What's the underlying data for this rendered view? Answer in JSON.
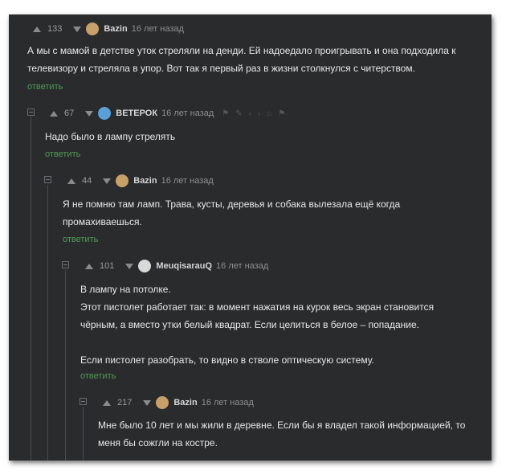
{
  "reply_label": "ответить",
  "comments": [
    {
      "rating": "133",
      "author": "Bazin",
      "date": "16 лет назад",
      "avatar_color": "#c8a06a",
      "text": "А мы с мамой в детстве уток стреляли на денди. Ей надоедало проигрывать и она подходила к\nтелевизору и стреляла в упор. Вот так я первый раз в жизни столкнулся с читерством."
    },
    {
      "rating": "67",
      "author": "ВЕТЕРОК",
      "date": "16 лет назад",
      "avatar_color": "#5aa0d8",
      "text": "Надо было в лампу стрелять",
      "tools": [
        "⚑",
        "✎",
        "‹",
        "›",
        "⌂",
        "⚑"
      ]
    },
    {
      "rating": "44",
      "author": "Bazin",
      "date": "16 лет назад",
      "avatar_color": "#c8a06a",
      "text": "Я не помню там ламп. Трава, кусты, деревья и собака вылезала ещё когда\nпромахиваешься."
    },
    {
      "rating": "101",
      "author": "MeuqisarauQ",
      "date": "16 лет назад",
      "avatar_color": "#d9d9d9",
      "text": "В лампу на потолке.\nЭтот пистолет работает так: в момент нажатия на курок весь экран становится\nчёрным, а вместо утки белый квадрат. Если целиться в белое – попадание.\n\nЕсли пистолет разобрать, то видно в стволе оптическую систему."
    },
    {
      "rating": "217",
      "author": "Bazin",
      "date": "16 лет назад",
      "avatar_color": "#c8a06a",
      "text": "Мне было 10 лет и мы жили в деревне. Если бы я владел такой информацией, то\nменя бы сожгли на костре."
    }
  ]
}
